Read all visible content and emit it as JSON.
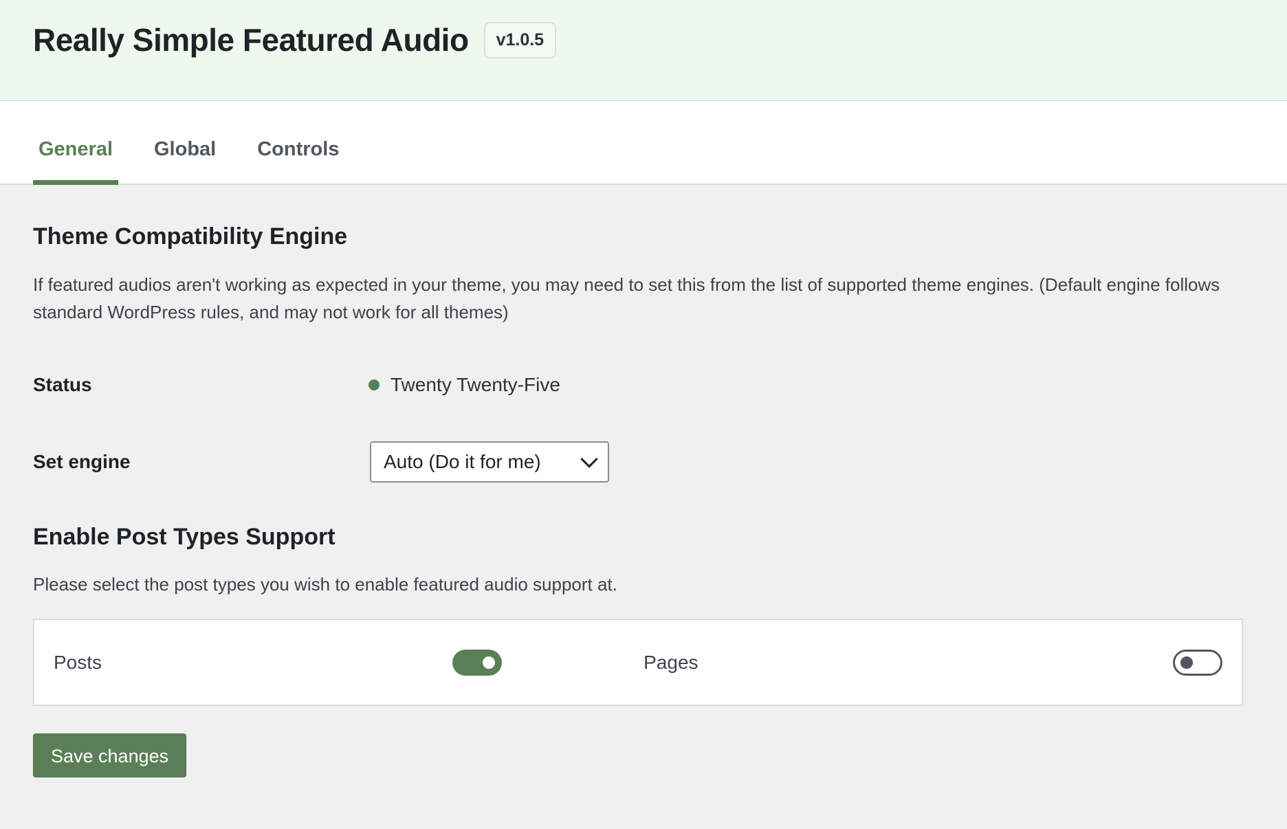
{
  "header": {
    "title": "Really Simple Featured Audio",
    "version": "v1.0.5"
  },
  "tabs": [
    {
      "label": "General",
      "active": true
    },
    {
      "label": "Global",
      "active": false
    },
    {
      "label": "Controls",
      "active": false
    }
  ],
  "theme_section": {
    "title": "Theme Compatibility Engine",
    "description": "If featured audios aren't working as expected in your theme, you may need to set this from the list of supported theme engines. (Default engine follows standard WordPress rules, and may not work for all themes)",
    "status_label": "Status",
    "status_value": "Twenty Twenty-Five",
    "engine_label": "Set engine",
    "engine_selected": "Auto (Do it for me)"
  },
  "post_types_section": {
    "title": "Enable Post Types Support",
    "description": "Please select the post types you wish to enable featured audio support at.",
    "items": [
      {
        "label": "Posts",
        "enabled": true
      },
      {
        "label": "Pages",
        "enabled": false
      }
    ]
  },
  "save_label": "Save changes",
  "colors": {
    "accent": "#5a7f56",
    "header_bg": "#eff8ee",
    "page_bg": "#f0f0f0"
  }
}
